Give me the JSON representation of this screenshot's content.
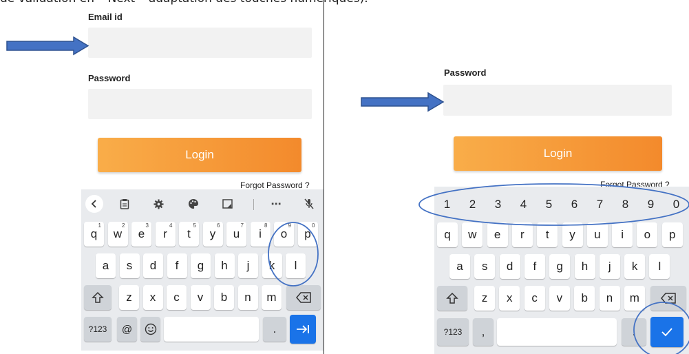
{
  "caption": "de validation en “ Next ” adaptation des touches numériques).",
  "left": {
    "email_label": "Email id",
    "password_label": "Password",
    "login_label": "Login",
    "forgot_label": "Forgot Password ?",
    "keyboard": {
      "toolbar": [
        "chevron-left-icon",
        "clipboard-icon",
        "gear-icon",
        "palette-icon",
        "image-icon",
        "more-icon",
        "mic-off-icon"
      ],
      "row1": [
        {
          "k": "q",
          "h": "1"
        },
        {
          "k": "w",
          "h": "2"
        },
        {
          "k": "e",
          "h": "3"
        },
        {
          "k": "r",
          "h": "4"
        },
        {
          "k": "t",
          "h": "5"
        },
        {
          "k": "y",
          "h": "6"
        },
        {
          "k": "u",
          "h": "7"
        },
        {
          "k": "i",
          "h": "8"
        },
        {
          "k": "o",
          "h": "9"
        },
        {
          "k": "p",
          "h": "0"
        }
      ],
      "row2": [
        "a",
        "s",
        "d",
        "f",
        "g",
        "h",
        "j",
        "k",
        "l"
      ],
      "row3": [
        "z",
        "x",
        "c",
        "v",
        "b",
        "n",
        "m"
      ],
      "sym_label": "?123",
      "at_label": "@",
      "period_label": ".",
      "action_icon": "next-tab-icon"
    }
  },
  "right": {
    "password_label": "Password",
    "login_label": "Login",
    "forgot_label": "Forgot Password ?",
    "keyboard": {
      "numbers": [
        "1",
        "2",
        "3",
        "4",
        "5",
        "6",
        "7",
        "8",
        "9",
        "0"
      ],
      "row1": [
        "q",
        "w",
        "e",
        "r",
        "t",
        "y",
        "u",
        "i",
        "o",
        "p"
      ],
      "row2": [
        "a",
        "s",
        "d",
        "f",
        "g",
        "h",
        "j",
        "k",
        "l"
      ],
      "row3": [
        "z",
        "x",
        "c",
        "v",
        "b",
        "n",
        "m"
      ],
      "sym_label": "?123",
      "comma_label": ",",
      "period_label": ".",
      "action_icon": "check-icon"
    }
  },
  "colors": {
    "accent_blue": "#1a73e8",
    "annotation_blue": "#4472c4",
    "login_orange": "#f6a03c"
  }
}
